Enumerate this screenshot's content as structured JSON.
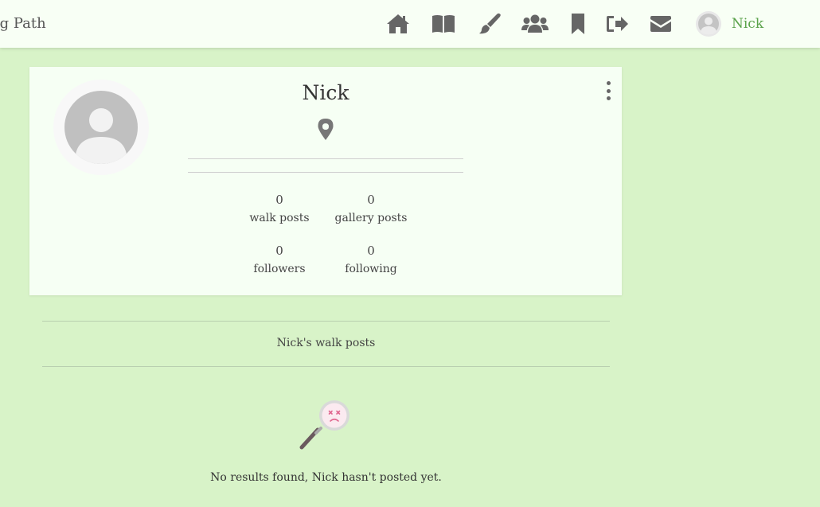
{
  "navbar": {
    "brand": "ng Path",
    "icons": [
      {
        "name": "home-icon",
        "label": "Home"
      },
      {
        "name": "book-icon",
        "label": "Walks"
      },
      {
        "name": "brush-icon",
        "label": "Gallery"
      },
      {
        "name": "users-icon",
        "label": "Community"
      },
      {
        "name": "bookmark-icon",
        "label": "Bookmarks"
      },
      {
        "name": "sign-out-icon",
        "label": "Logout"
      },
      {
        "name": "envelope-icon",
        "label": "Messages"
      }
    ],
    "username": "Nick"
  },
  "profile": {
    "name": "Nick",
    "stats": {
      "walk_posts": {
        "count": "0",
        "label": "walk posts"
      },
      "gallery_posts": {
        "count": "0",
        "label": "gallery posts"
      },
      "followers": {
        "count": "0",
        "label": "followers"
      },
      "following": {
        "count": "0",
        "label": "following"
      }
    }
  },
  "posts_section": {
    "title": "Nick's walk posts",
    "empty_message": "No results found, Nick hasn't posted yet."
  },
  "colors": {
    "background": "#d8f3c8",
    "navbar": "#f8fff5",
    "card": "#f6fff4",
    "accent": "#5aa24a",
    "icon": "#666666"
  }
}
